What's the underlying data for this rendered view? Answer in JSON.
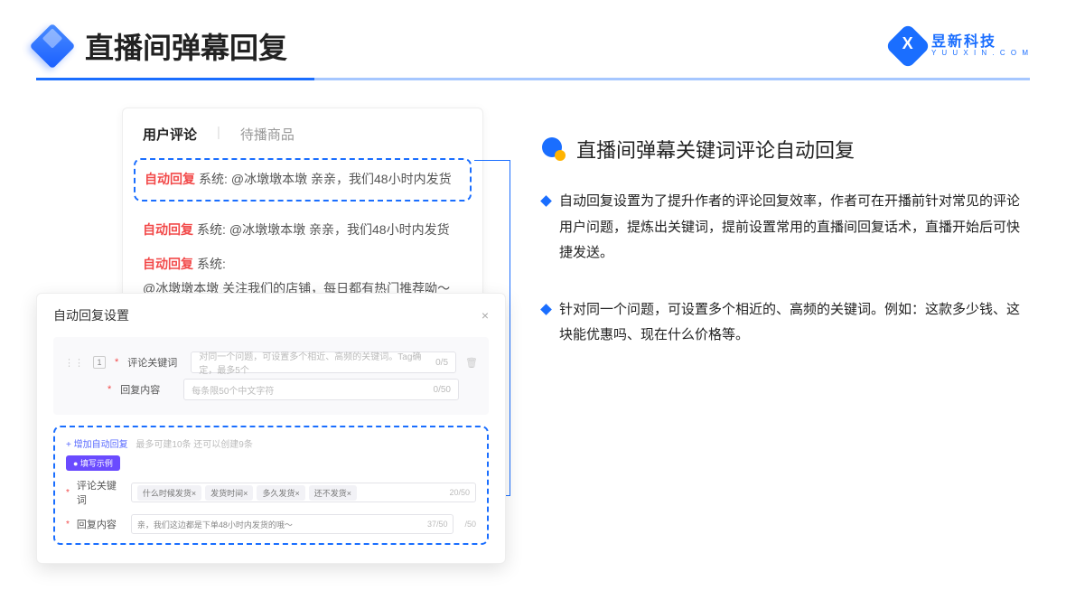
{
  "header": {
    "page_title": "直播间弹幕回复",
    "brand_cn": "昱新科技",
    "brand_en": "Y U U X I N . C O M"
  },
  "comment_panel": {
    "tab_active": "用户评论",
    "tab_inactive": "待播商品",
    "rows": [
      {
        "badge": "自动回复",
        "sys": "系统:",
        "text": "@冰墩墩本墩 亲亲，我们48小时内发货"
      },
      {
        "badge": "自动回复",
        "sys": "系统:",
        "text": "@冰墩墩本墩 亲亲，我们48小时内发货"
      },
      {
        "badge": "自动回复",
        "sys": "系统:",
        "text": "@冰墩墩本墩 关注我们的店铺，每日都有热门推荐呦～"
      }
    ]
  },
  "modal": {
    "title": "自动回复设置",
    "index": "1",
    "label_keyword": "评论关键词",
    "placeholder_keyword": "对同一个问题，可设置多个相近、高频的关键词。Tag确定，最多5个",
    "count_keyword": "0/5",
    "label_content": "回复内容",
    "placeholder_content": "每条限50个中文字符",
    "count_content": "0/50",
    "add_link": "+ 增加自动回复",
    "add_hint": "最多可建10条 还可以创建9条",
    "pill": "● 填写示例",
    "ex_label_keyword": "评论关键词",
    "ex_tags": [
      "什么时候发货×",
      "发货时间×",
      "多久发货×",
      "还不发货×"
    ],
    "ex_count_keyword": "20/50",
    "ex_label_content": "回复内容",
    "ex_content_value": "亲，我们这边都是下单48小时内发货的哦～",
    "ex_count_content": "37/50",
    "trailing_count": "/50"
  },
  "right": {
    "heading": "直播间弹幕关键词评论自动回复",
    "bullets": [
      "自动回复设置为了提升作者的评论回复效率，作者可在开播前针对常见的评论用户问题，提炼出关键词，提前设置常用的直播间回复话术，直播开始后可快捷发送。",
      "针对同一个问题，可设置多个相近的、高频的关键词。例如：这款多少钱、这块能优惠吗、现在什么价格等。"
    ]
  }
}
